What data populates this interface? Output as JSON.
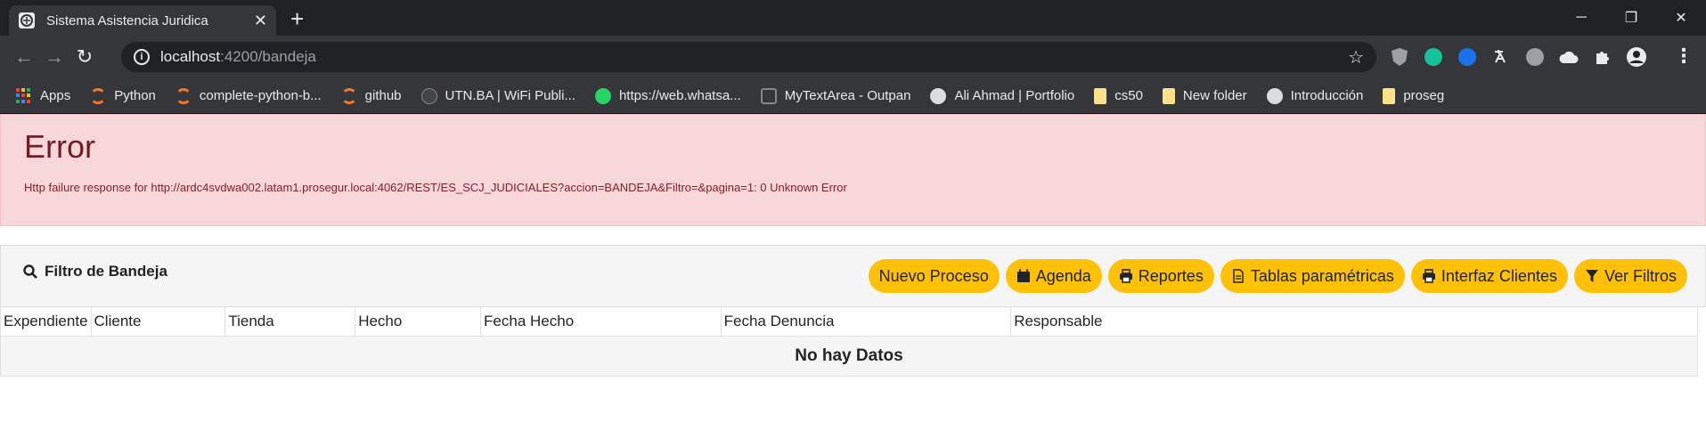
{
  "browser": {
    "tab_title": "Sistema Asistencia Juridica",
    "url_host": "localhost",
    "url_path": ":4200/bandeja",
    "bookmarks": [
      {
        "label": "Apps",
        "icon": "apps"
      },
      {
        "label": "Python",
        "icon": "ring"
      },
      {
        "label": "complete-python-b...",
        "icon": "ring"
      },
      {
        "label": "github",
        "icon": "ring"
      },
      {
        "label": "UTN.BA | WiFi Publi...",
        "icon": "dark"
      },
      {
        "label": "https://web.whatsa...",
        "icon": "wa"
      },
      {
        "label": "MyTextArea - Outpan",
        "icon": "sq"
      },
      {
        "label": "Ali Ahmad | Portfolio",
        "icon": "globe"
      },
      {
        "label": "cs50",
        "icon": "folder"
      },
      {
        "label": "New folder",
        "icon": "folder"
      },
      {
        "label": "Introducción",
        "icon": "globe"
      },
      {
        "label": "proseg",
        "icon": "folder"
      }
    ]
  },
  "alert": {
    "title": "Error",
    "message": "Http failure response for http://ardc4svdwa002.latam1.prosegur.local:4062/REST/ES_SCJ_JUDICIALES?accion=BANDEJA&Filtro=&pagina=1: 0 Unknown Error"
  },
  "filter": {
    "title": "Filtro de Bandeja",
    "buttons": {
      "nuevo": "Nuevo Proceso",
      "agenda": "Agenda",
      "reportes": "Reportes",
      "tablas": "Tablas paramétricas",
      "interfaz": "Interfaz Clientes",
      "filtros": "Ver Filtros"
    }
  },
  "table": {
    "columns": [
      "Expendiente",
      "Cliente",
      "Tienda",
      "Hecho",
      "Fecha Hecho",
      "Fecha Denuncia",
      "Responsable"
    ],
    "empty_text": "No hay Datos"
  },
  "colors": {
    "button": "#ffc107",
    "alert_bg": "#f8d7da",
    "alert_text": "#842029"
  }
}
